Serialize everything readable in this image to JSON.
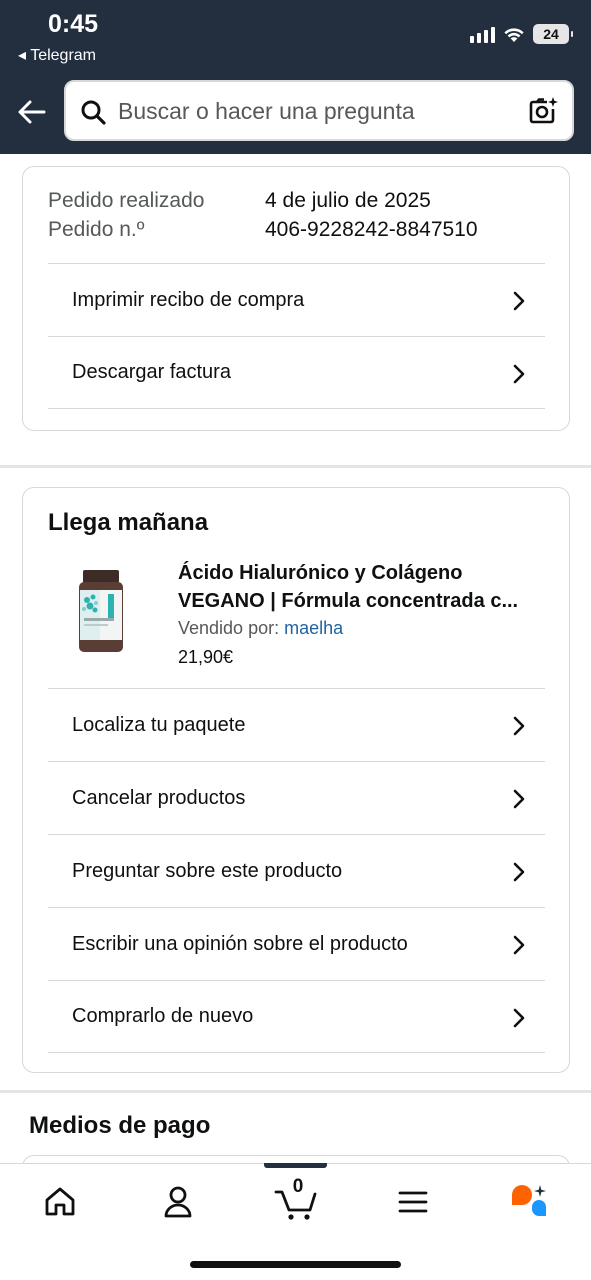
{
  "status_bar": {
    "time": "0:45",
    "back_app": "◂ Telegram",
    "battery": "24"
  },
  "search": {
    "placeholder": "Buscar o hacer una pregunta"
  },
  "order": {
    "placed_label": "Pedido realizado",
    "placed_value": "4 de julio de 2025",
    "number_label": "Pedido n.º",
    "number_value": "406-9228242-8847510",
    "actions": [
      "Imprimir recibo de compra",
      "Descargar factura"
    ]
  },
  "shipment": {
    "title": "Llega mañana",
    "product": {
      "title_line1": "Ácido Hialurónico y Colágeno",
      "title_line2": "VEGANO | Fórmula concentrada c...",
      "sold_by_label": "Vendido por: ",
      "seller": "maelha",
      "price": "21,90€"
    },
    "actions": [
      "Localiza tu paquete",
      "Cancelar productos",
      "Preguntar sobre este producto",
      "Escribir una opinión sobre el producto",
      "Comprarlo de nuevo"
    ]
  },
  "payment": {
    "title": "Medios de pago"
  },
  "tabbar": {
    "cart_count": "0",
    "icons": [
      "home-icon",
      "account-icon",
      "cart-icon",
      "menu-icon",
      "rufus-icon"
    ]
  },
  "colors": {
    "header": "#232f3e",
    "link": "#2162a1",
    "rufus_orange": "#ff6200",
    "rufus_blue": "#1a98ff"
  }
}
